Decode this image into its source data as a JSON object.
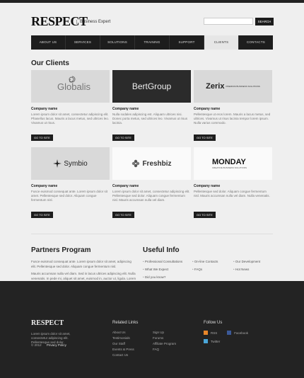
{
  "header": {
    "logo": "RESPECT",
    "tagline": "Business Expert",
    "search_placeholder": "",
    "search_button": "SEARCH"
  },
  "nav": {
    "items": [
      "ABOUT US",
      "SERVICES",
      "SOLUTIONS",
      "TRAINING",
      "SUPPORT",
      "CLIENTS",
      "CONTACTS"
    ],
    "active_index": 5
  },
  "clients": {
    "title": "Our Clients",
    "items": [
      {
        "logo": "Globalis",
        "name": "Company name",
        "desc": "Lorem ipsum dolor sit amet, consectetur adipiscing elit. Phasellus lacus. Mauris a lacus metus, sed ultrices leo. Vivamus ut risus.",
        "button": "GO TO SITE"
      },
      {
        "logo": "BertGroup",
        "name": "Company name",
        "desc": "Nulla sodales adipiscing est. Aliquam ultrices nisi. Donec porta metus, sed ultrices leo. Vivamus ut risus lacinia.",
        "button": "GO TO SITE"
      },
      {
        "logo": "Zerix",
        "logo_sub": "PREMIUM BUSINESS SOLUTIONS",
        "name": "Company name",
        "desc": "Pellentesque ut eros lorem. Mauris a lacus metus, sed ultrices. Vivamus ut risus lacinia tempor lorem ipsum. Nulla varius commodo.",
        "button": "GO TO SITE"
      },
      {
        "logo": "Symbio",
        "name": "Company name",
        "desc": "Fusce euismod consequat ante. Lorem ipsum dolor sit amet. Pellentesque sed dolor. Aliquam congue fermentum nisl.",
        "button": "GO TO SITE"
      },
      {
        "logo": "Freshbiz",
        "name": "Company name",
        "desc": "Lorem ipsum dolor sit amet, consectetur adipiscing elit. Pellentesque sed dolor. Aliquam congue fermentum nisl. Mauris accumsan nulla vel diam.",
        "button": "GO TO SITE"
      },
      {
        "logo": "MONDAY",
        "logo_sub": "CREATIVE BUSINESS SOLUTIONS",
        "name": "Company name",
        "desc": "Pellentesque sed dolor. Aliquam congue fermentum nisl. Mauris accumsan nulla vel diam. Nulla venenatis.",
        "button": "GO TO SITE"
      }
    ]
  },
  "partners": {
    "title": "Partners Program",
    "p1": "Fusce euismod consequat ante. Lorem ipsum dolor sit amet, adipiscing elit. Pellentesque sed dolor. Aliquam congue fermentum nisl.",
    "p2": "Mauris accumsan nulla vel diam. Sed in lacus ultrices adipiscing elit. Nulla venenatis. In pede mi, aliquet sit amet, euismod in, auctor ut, ligula. Lorem ipsum dolor sit amet, consectetur adipiscing elit."
  },
  "useful": {
    "title": "Useful Info",
    "col1": [
      "Professional Consultations",
      "What We Expect",
      "Did you know?"
    ],
    "col2": [
      "On-line Contacts",
      "FAQs"
    ],
    "col3": [
      "Our Development",
      "Hot News"
    ]
  },
  "footer": {
    "logo": "RESPECT",
    "desc": "Lorem ipsum dolor sit amet, consectetur adipiscing elit. Pellentesque sed dolor.",
    "copyright": "© 2012",
    "privacy": "Privacy Policy",
    "related_title": "Related Links",
    "related_col1": [
      "About Us",
      "Testimonials",
      "Our Staff",
      "Events & Press",
      "Contact Us"
    ],
    "related_col2": [
      "Sign Up",
      "Forums",
      "Affiliate Program",
      "FAQ"
    ],
    "follow_title": "Follow Us",
    "follow": [
      {
        "label": "RSS",
        "icon": "rss-icon",
        "color": "#e8862a"
      },
      {
        "label": "Facebook",
        "icon": "facebook-icon",
        "color": "#3b5998"
      },
      {
        "label": "Twitter",
        "icon": "twitter-icon",
        "color": "#4aa6d9"
      }
    ]
  }
}
